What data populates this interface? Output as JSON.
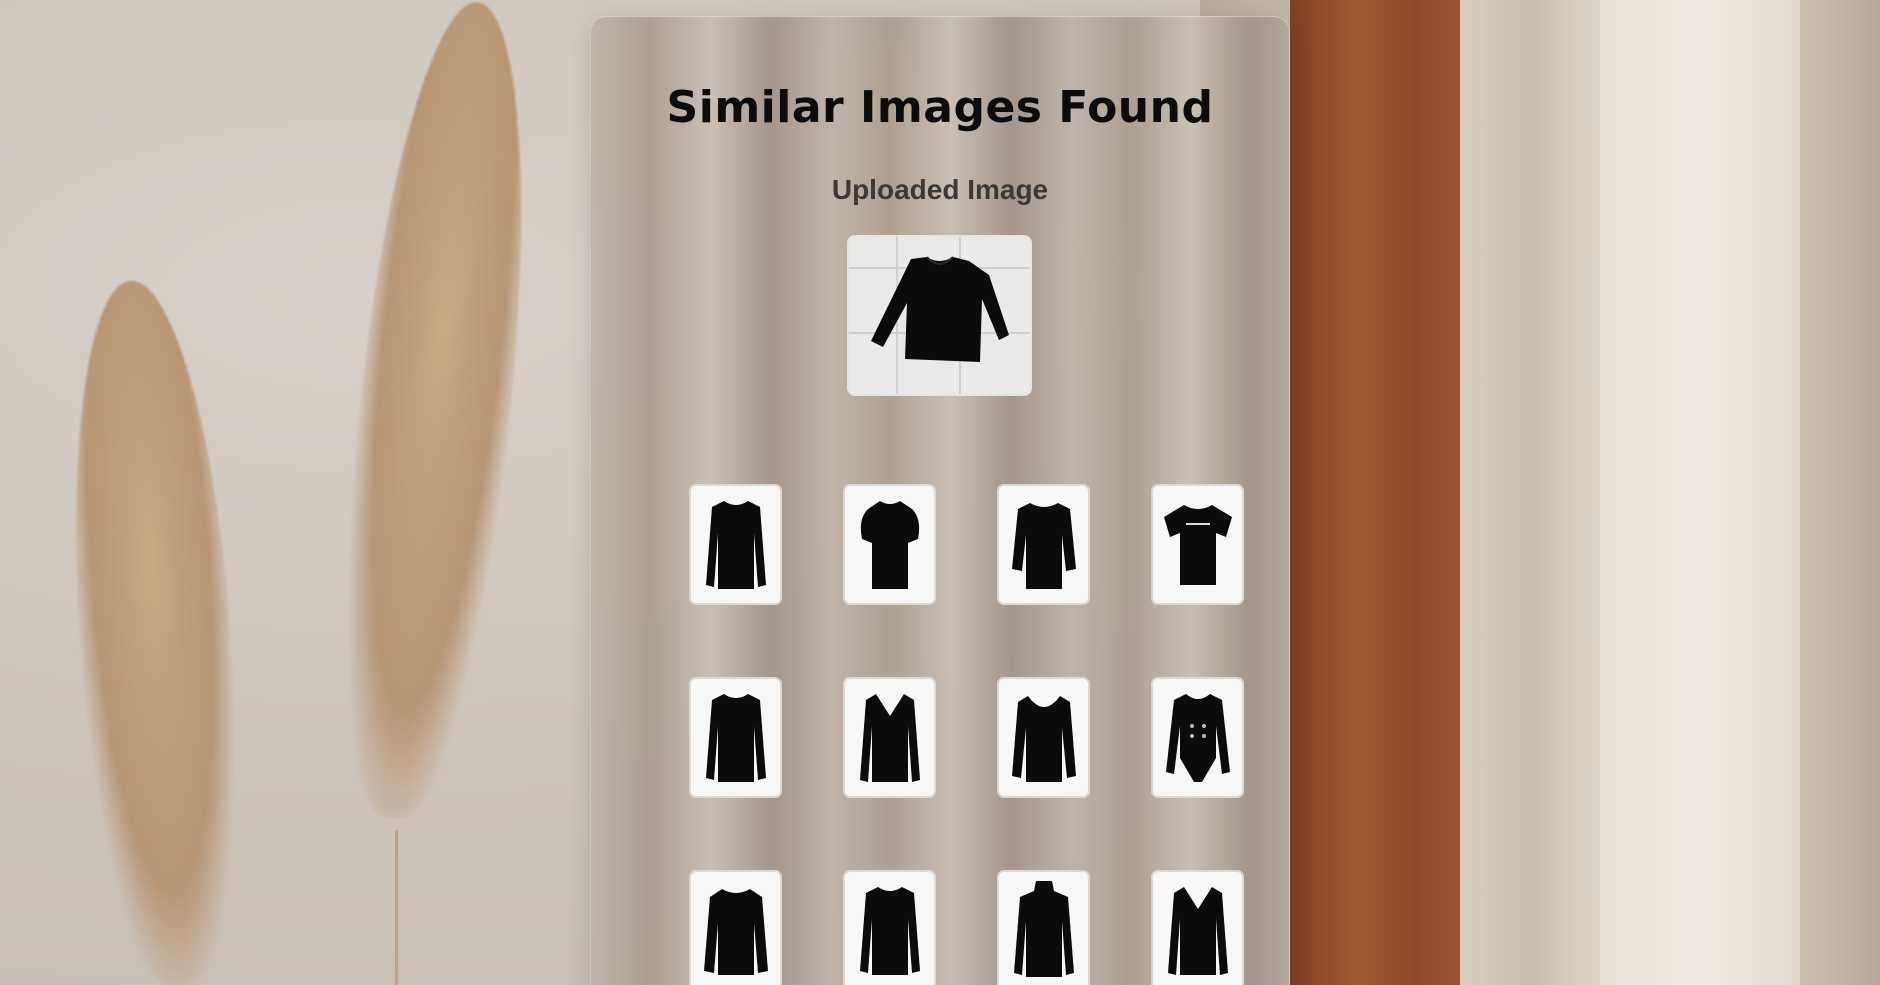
{
  "page": {
    "title": "Similar Images Found",
    "subtitle": "Uploaded Image"
  },
  "uploaded_image": {
    "icon": "black-sweater-icon"
  },
  "results": [
    {
      "icon": "long-sleeve-top-icon"
    },
    {
      "icon": "puff-sleeve-top-icon"
    },
    {
      "icon": "three-quarter-sleeve-top-icon"
    },
    {
      "icon": "tshirt-icon"
    },
    {
      "icon": "long-sleeve-top-icon"
    },
    {
      "icon": "wrap-top-icon"
    },
    {
      "icon": "scoop-neck-top-icon"
    },
    {
      "icon": "button-bodysuit-icon"
    },
    {
      "icon": "sweater-icon"
    },
    {
      "icon": "long-sleeve-top-icon"
    },
    {
      "icon": "turtleneck-icon"
    },
    {
      "icon": "wrap-top-icon"
    }
  ],
  "colors": {
    "garment": "#0b0b0b",
    "card_tint": "#b4a89d",
    "title_text": "#0c0c0c",
    "subtitle_text": "#3b3836"
  }
}
